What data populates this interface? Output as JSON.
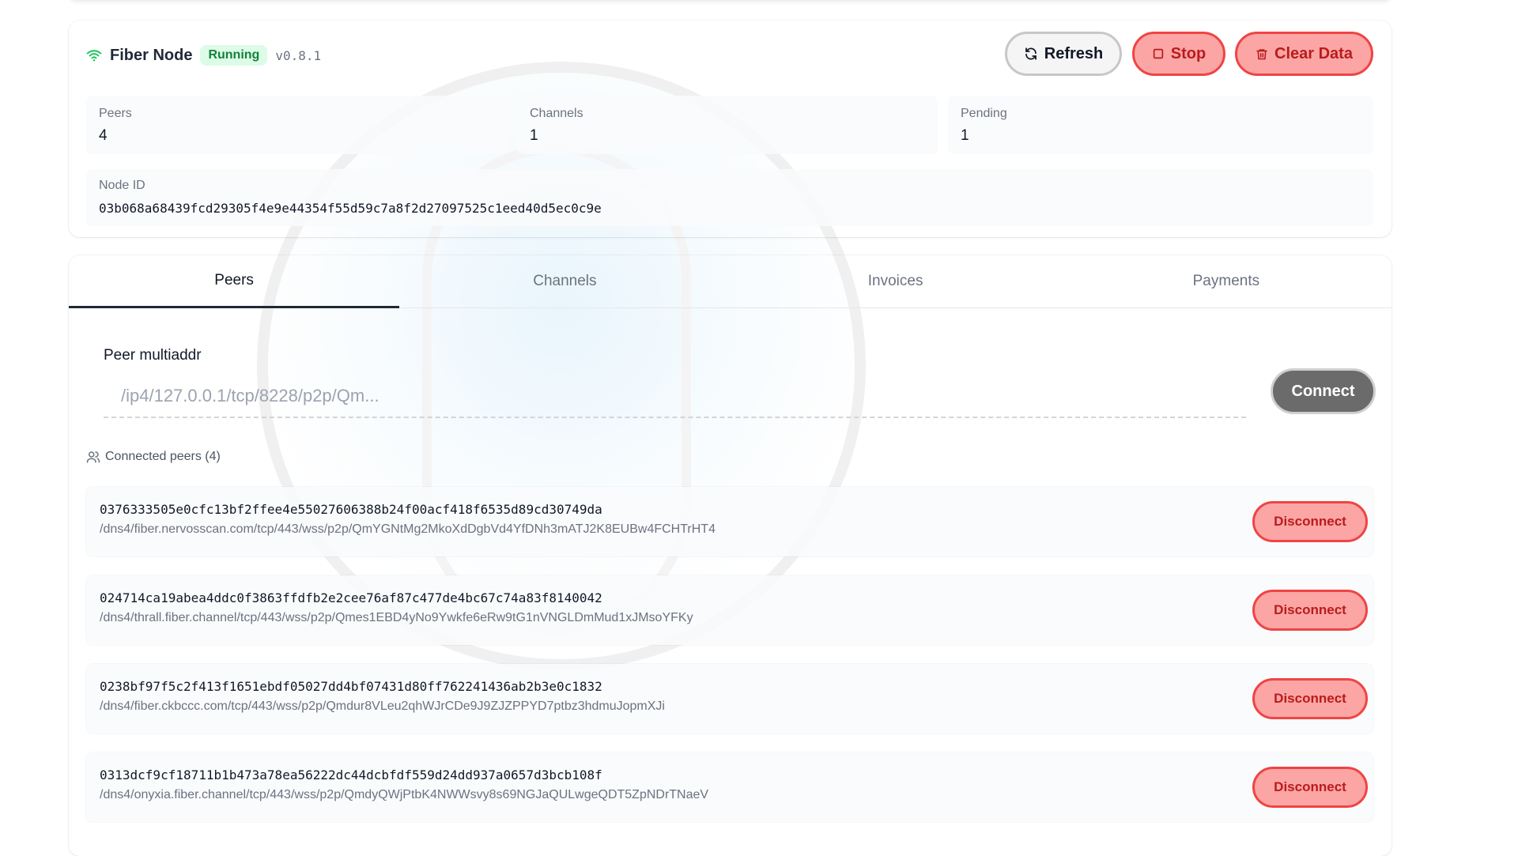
{
  "node": {
    "title": "Fiber Node",
    "status": "Running",
    "version": "v0.8.1",
    "buttons": {
      "refresh": "Refresh",
      "stop": "Stop",
      "clear": "Clear Data"
    },
    "stats": [
      {
        "label": "Peers",
        "value": "4"
      },
      {
        "label": "Channels",
        "value": "1"
      },
      {
        "label": "Pending",
        "value": "1"
      }
    ],
    "node_id_label": "Node ID",
    "node_id": "03b068a68439fcd29305f4e9e44354f55d59c7a8f2d27097525c1eed40d5ec0c9e"
  },
  "tabs": [
    {
      "label": "Peers",
      "active": true
    },
    {
      "label": "Channels",
      "active": false
    },
    {
      "label": "Invoices",
      "active": false
    },
    {
      "label": "Payments",
      "active": false
    }
  ],
  "connect": {
    "label": "Peer multiaddr",
    "placeholder": "/ip4/127.0.0.1/tcp/8228/p2p/Qm...",
    "value": "",
    "button": "Connect"
  },
  "peers": {
    "heading": "Connected peers (4)",
    "disconnect_label": "Disconnect",
    "items": [
      {
        "id": "0376333505e0cfc13bf2ffee4e55027606388b24f00acf418f6535d89cd30749da",
        "addr": "/dns4/fiber.nervosscan.com/tcp/443/wss/p2p/QmYGNtMg2MkoXdDgbVd4YfDNh3mATJ2K8EUBw4FCHTrHT4"
      },
      {
        "id": "024714ca19abea4ddc0f3863ffdfb2e2cee76af87c477de4bc67c74a83f8140042",
        "addr": "/dns4/thrall.fiber.channel/tcp/443/wss/p2p/Qmes1EBD4yNo9Ywkfe6eRw9tG1nVNGLDmMud1xJMsoYFKy"
      },
      {
        "id": "0238bf97f5c2f413f1651ebdf05027dd4bf07431d80ff762241436ab2b3e0c1832",
        "addr": "/dns4/fiber.ckbccc.com/tcp/443/wss/p2p/Qmdur8VLeu2qhWJrCDe9J9ZJZPPYD7ptbz3hdmuJopmXJi"
      },
      {
        "id": "0313dcf9cf18711b1b473a78ea56222dc44dcbfdf559d24dd937a0657d3bcb108f",
        "addr": "/dns4/onyxia.fiber.channel/tcp/443/wss/p2p/QmdyQWjPtbK4NWWsvy8s69NGJaQULwgeQDT5ZpNDrTNaeV"
      }
    ]
  },
  "colors": {
    "danger": "#ef4444",
    "danger_fill": "#fca5a5",
    "success_bg": "#dcfce7",
    "success_text": "#15803d"
  },
  "icons": {
    "status": "wifi-icon",
    "refresh": "refresh-icon",
    "stop": "stop-icon",
    "clear": "trash-icon",
    "peers": "users-icon"
  }
}
